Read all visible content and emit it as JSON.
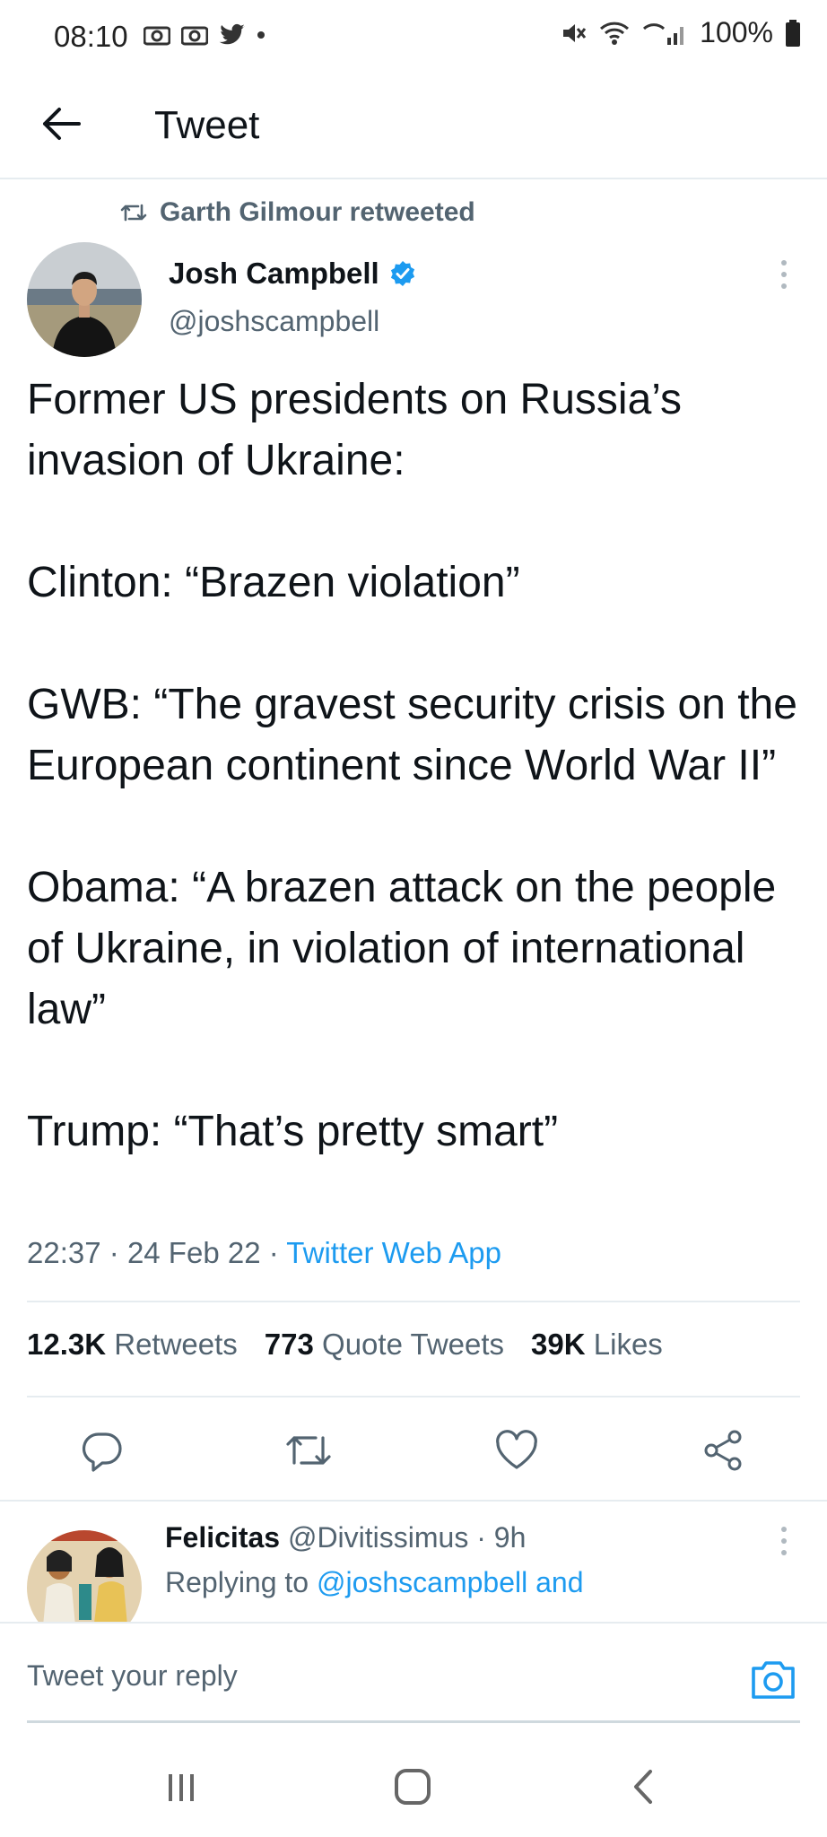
{
  "status_bar": {
    "time": "08:10",
    "battery": "100%"
  },
  "header": {
    "title": "Tweet"
  },
  "retweet": {
    "text": "Garth Gilmour retweeted"
  },
  "tweet": {
    "author_name": "Josh Campbell",
    "author_handle": "@joshscampbell",
    "body": "Former US presidents on Russia’s invasion of Ukraine:\n\nClinton: “Brazen violation”\n\nGWB: “The gravest security crisis on the European continent since World War II”\n\nObama: “A brazen attack on the people of Ukraine, in violation of international law”\n\nTrump: “That’s pretty smart”",
    "time": "22:37",
    "date": "24 Feb 22",
    "source": "Twitter Web App"
  },
  "stats": {
    "retweets_count": "12.3K",
    "retweets_label": "Retweets",
    "quotes_count": "773",
    "quotes_label": "Quote Tweets",
    "likes_count": "39K",
    "likes_label": "Likes"
  },
  "reply": {
    "name": "Felicitas",
    "handle": "@Divitissimus",
    "age": "9h",
    "replying_prefix": "Replying to",
    "replying_to": "@joshscampbell and"
  },
  "composer": {
    "placeholder": "Tweet your reply"
  },
  "colors": {
    "accent": "#1d9bf0",
    "secondary_text": "#536471",
    "divider": "#e6ecf0"
  }
}
